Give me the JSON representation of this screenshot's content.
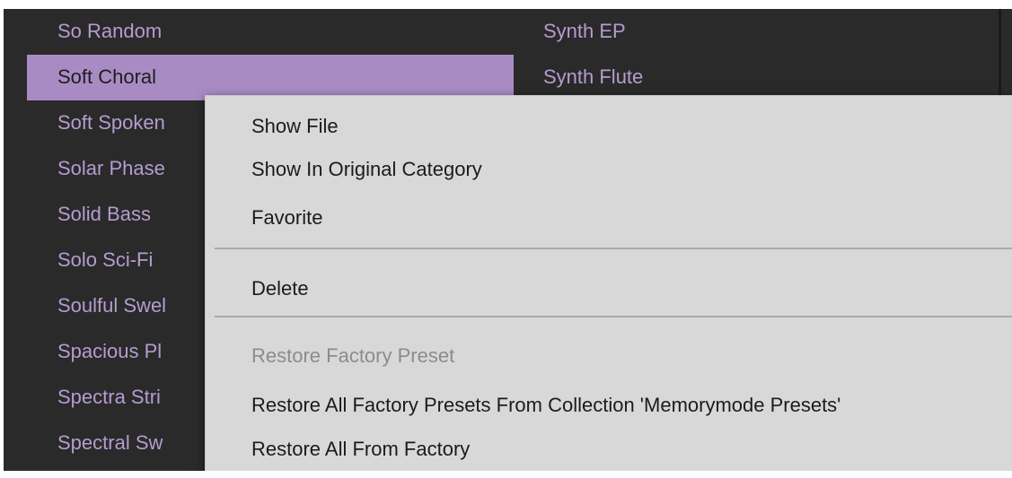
{
  "preset_list": {
    "left_column": [
      {
        "label": "So Random",
        "selected": false
      },
      {
        "label": "Soft Choral",
        "selected": true
      },
      {
        "label": "Soft Spoken",
        "selected": false
      },
      {
        "label": "Solar Phase",
        "selected": false
      },
      {
        "label": "Solid Bass",
        "selected": false
      },
      {
        "label": "Solo Sci-Fi",
        "selected": false
      },
      {
        "label": "Soulful Swel",
        "selected": false
      },
      {
        "label": "Spacious Pl",
        "selected": false
      },
      {
        "label": "Spectra Stri",
        "selected": false
      },
      {
        "label": "Spectral Sw",
        "selected": false
      }
    ],
    "right_column": [
      {
        "label": "Synth EP",
        "selected": false
      },
      {
        "label": "Synth Flute",
        "selected": false
      }
    ]
  },
  "context_menu": {
    "items": [
      {
        "label": "Show File",
        "enabled": true
      },
      {
        "label": "Show In Original Category",
        "enabled": true
      },
      {
        "label": "Favorite",
        "enabled": true
      },
      {
        "label": "Delete",
        "enabled": true
      },
      {
        "label": "Restore Factory Preset",
        "enabled": false
      },
      {
        "label": "Restore All Factory Presets From Collection 'Memorymode Presets'",
        "enabled": true
      },
      {
        "label": "Restore All From Factory",
        "enabled": true
      }
    ]
  },
  "colors": {
    "background": "#2a2a2a",
    "preset_text": "#b59cd0",
    "selected_row": "#a98bc4",
    "menu_background": "#d8d8d8",
    "menu_disabled_text": "#8c8c8c"
  }
}
